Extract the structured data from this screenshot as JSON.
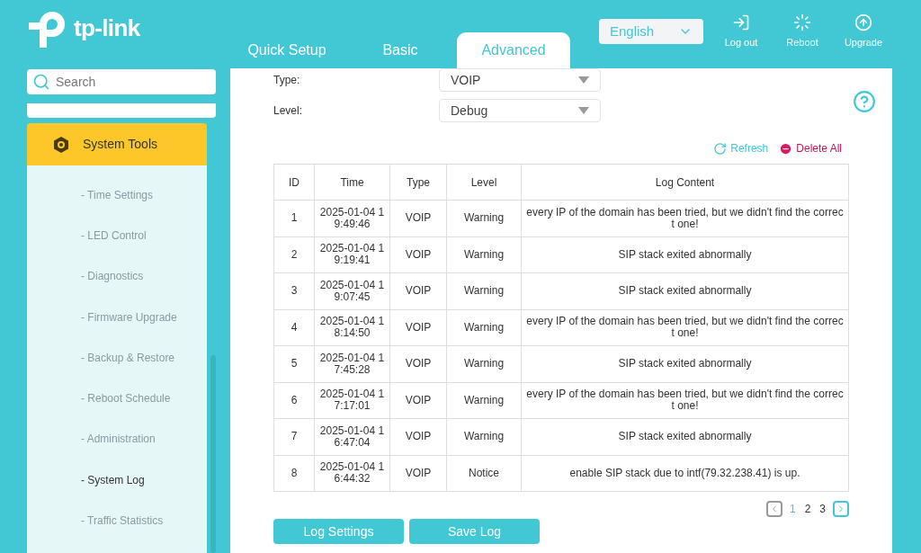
{
  "logo": {
    "text": "tp-link"
  },
  "tabs": [
    {
      "label": "Quick Setup",
      "selected": false
    },
    {
      "label": "Basic",
      "selected": false
    },
    {
      "label": "Advanced",
      "selected": true
    }
  ],
  "language": {
    "value": "English"
  },
  "header_actions": [
    {
      "kind": "logout",
      "label": "Log out"
    },
    {
      "kind": "reboot",
      "label": "Reboot"
    },
    {
      "kind": "upgrade",
      "label": "Upgrade"
    }
  ],
  "sidebar": {
    "search": {
      "placeholder": "Search"
    },
    "section": {
      "label": "System Tools",
      "expanded": true
    },
    "items": [
      {
        "label": "- Time Settings",
        "selected": false
      },
      {
        "label": "- LED Control",
        "selected": false
      },
      {
        "label": "- Diagnostics",
        "selected": false
      },
      {
        "label": "- Firmware Upgrade",
        "selected": false
      },
      {
        "label": "- Backup & Restore",
        "selected": false
      },
      {
        "label": "- Reboot Schedule",
        "selected": false
      },
      {
        "label": "- Administration",
        "selected": false
      },
      {
        "label": "- System Log",
        "selected": true
      },
      {
        "label": "- Traffic Statistics",
        "selected": false
      }
    ]
  },
  "filters": [
    {
      "label": "Type:",
      "value": "VOIP"
    },
    {
      "label": "Level:",
      "value": "Debug"
    }
  ],
  "toolbar": {
    "refresh": "Refresh",
    "delete_all": "Delete All"
  },
  "table": {
    "columns": [
      "ID",
      "Time",
      "Type",
      "Level",
      "Log Content"
    ],
    "rows": [
      [
        "1",
        "2025-01-04 19:49:46",
        "VOIP",
        "Warning",
        "every IP of the domain has been tried, but we didn't find the correct one!"
      ],
      [
        "2",
        "2025-01-04 19:19:41",
        "VOIP",
        "Warning",
        "SIP stack exited abnormally"
      ],
      [
        "3",
        "2025-01-04 19:07:45",
        "VOIP",
        "Warning",
        "SIP stack exited abnormally"
      ],
      [
        "4",
        "2025-01-04 18:14:50",
        "VOIP",
        "Warning",
        "every IP of the domain has been tried, but we didn't find the correct one!"
      ],
      [
        "5",
        "2025-01-04 17:45:28",
        "VOIP",
        "Warning",
        "SIP stack exited abnormally"
      ],
      [
        "6",
        "2025-01-04 17:17:01",
        "VOIP",
        "Warning",
        "every IP of the domain has been tried, but we didn't find the correct one!"
      ],
      [
        "7",
        "2025-01-04 16:47:04",
        "VOIP",
        "Warning",
        "SIP stack exited abnormally"
      ],
      [
        "8",
        "2025-01-04 16:44:32",
        "VOIP",
        "Notice",
        "enable SIP stack due to intf(79.32.238.41) is up."
      ]
    ]
  },
  "pagination": {
    "pages": [
      {
        "label": "1",
        "selected": true
      },
      {
        "label": "2",
        "selected": false
      },
      {
        "label": "3",
        "selected": false
      }
    ],
    "prev_disabled": true,
    "next_disabled": false
  },
  "buttons": [
    "Log Settings",
    "Save Log"
  ]
}
